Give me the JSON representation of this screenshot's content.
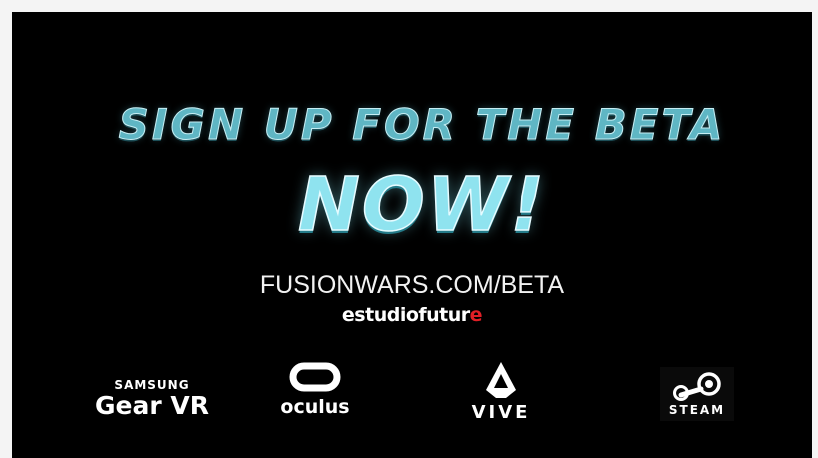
{
  "headline": "SIGN UP FOR THE BETA",
  "cta": "NOW!",
  "url": "FUSIONWARS.COM/BETA",
  "studio": {
    "name_main": "estudiofutur",
    "name_accent": "e"
  },
  "platforms": {
    "gearvr": {
      "brand": "SAMSUNG",
      "product": "Gear VR"
    },
    "oculus": {
      "word": "oculus",
      "icon": "oculus-logo-icon"
    },
    "vive": {
      "word": "VIVE",
      "icon": "vive-logo-icon"
    },
    "steam": {
      "word": "STEAM",
      "icon": "steam-logo-icon"
    }
  },
  "colors": {
    "background": "#000000",
    "headline": "#5fb6c4",
    "cta": "#8fe3ef",
    "studio_accent": "#e11f26"
  }
}
